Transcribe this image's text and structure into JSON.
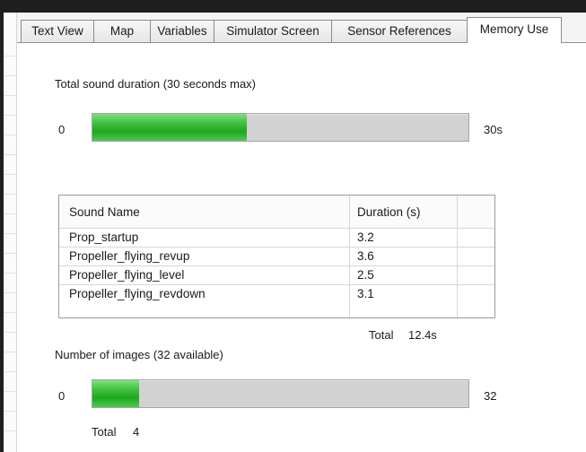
{
  "tabs": [
    {
      "label": "Text View"
    },
    {
      "label": "Map"
    },
    {
      "label": "Variables"
    },
    {
      "label": "Simulator Screen"
    },
    {
      "label": "Sensor References"
    },
    {
      "label": "Memory Use",
      "active": true
    }
  ],
  "sound": {
    "heading": "Total sound duration  (30 seconds max)",
    "min_label": "0",
    "max_label": "30s",
    "progress_fraction": 0.41
  },
  "table": {
    "columns": [
      "Sound Name",
      "Duration (s)"
    ],
    "rows": [
      {
        "name": "Prop_startup",
        "duration": "3.2"
      },
      {
        "name": "Propeller_flying_revup",
        "duration": "3.6"
      },
      {
        "name": "Propeller_flying_level",
        "duration": "2.5"
      },
      {
        "name": "Propeller_flying_revdown",
        "duration": "3.1"
      }
    ],
    "total_label": "Total",
    "total_value": "12.4s"
  },
  "images": {
    "heading": "Number of images (32 available)",
    "min_label": "0",
    "max_label": "32",
    "progress_fraction": 0.125,
    "total_label": "Total",
    "total_value": "4"
  },
  "colors": {
    "progress_green": "#1ea71e",
    "progress_track": "#d2d2d2"
  }
}
